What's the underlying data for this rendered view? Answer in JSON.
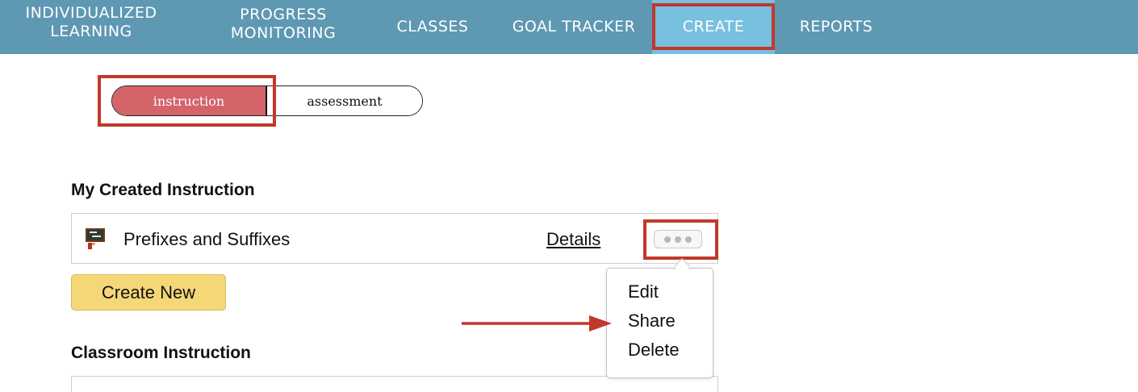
{
  "nav": {
    "items": [
      {
        "lines": [
          "INDIVIDUALIZED",
          "LEARNING"
        ]
      },
      {
        "lines": [
          "PROGRESS",
          "MONITORING"
        ]
      },
      {
        "lines": [
          "CLASSES"
        ]
      },
      {
        "lines": [
          "GOAL TRACKER"
        ]
      },
      {
        "lines": [
          "CREATE"
        ]
      },
      {
        "lines": [
          "REPORTS"
        ]
      }
    ],
    "active": "CREATE"
  },
  "toggle": {
    "options": [
      "instruction",
      "assessment"
    ],
    "selected": "instruction"
  },
  "my_created": {
    "title": "My Created Instruction",
    "items": [
      {
        "title": "Prefixes and Suffixes",
        "details_label": "Details",
        "icon": "chalkboard-icon"
      }
    ],
    "create_button": "Create New"
  },
  "menu": {
    "items": [
      "Edit",
      "Share",
      "Delete"
    ]
  },
  "classroom": {
    "title": "Classroom Instruction"
  },
  "colors": {
    "nav_bg": "#5e98b3",
    "nav_active_bg": "#78bfe0",
    "toggle_selected": "#d4636a",
    "create_button": "#f5d778",
    "annotation": "#c0392b"
  }
}
